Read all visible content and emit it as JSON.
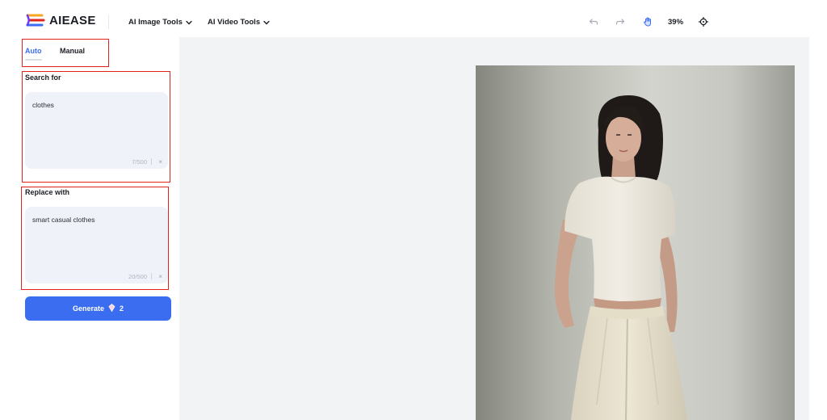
{
  "header": {
    "brand": "AIEASE",
    "nav": [
      {
        "label": "AI Image Tools"
      },
      {
        "label": "AI Video Tools"
      }
    ],
    "zoom": "39%"
  },
  "tabs": {
    "auto": "Auto",
    "manual": "Manual"
  },
  "search": {
    "label": "Search for",
    "value": "clothes",
    "count": "7/500",
    "clear": "×"
  },
  "replace": {
    "label": "Replace with",
    "value": "smart casual clothes",
    "count": "20/500",
    "clear": "×"
  },
  "generate": {
    "label": "Generate",
    "credits": "2"
  },
  "colors": {
    "accent": "#3a6df0",
    "highlight_box": "#e2231a"
  }
}
